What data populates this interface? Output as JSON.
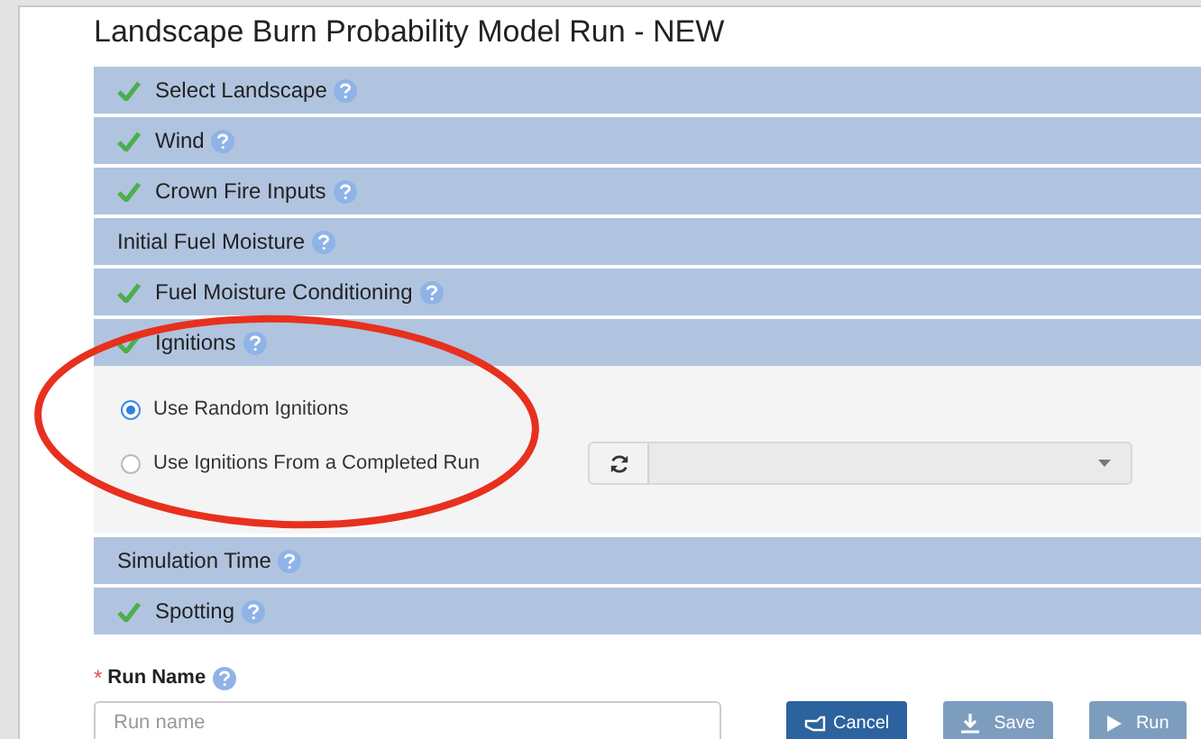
{
  "title": "Landscape Burn Probability Model Run - NEW",
  "sections": [
    {
      "label": "Select Landscape",
      "completed": true
    },
    {
      "label": "Wind",
      "completed": true
    },
    {
      "label": "Crown Fire Inputs",
      "completed": true
    },
    {
      "label": "Initial Fuel Moisture",
      "completed": false
    },
    {
      "label": "Fuel Moisture Conditioning",
      "completed": true
    },
    {
      "label": "Ignitions",
      "completed": true,
      "options": [
        {
          "label": "Use Random Ignitions",
          "selected": true
        },
        {
          "label": "Use Ignitions From a Completed Run",
          "selected": false
        }
      ]
    },
    {
      "label": "Simulation Time",
      "completed": false
    },
    {
      "label": "Spotting",
      "completed": true
    }
  ],
  "run_name": {
    "required_mark": "*",
    "label": "Run Name",
    "placeholder": "Run name"
  },
  "buttons": [
    {
      "label": "Cancel",
      "kind": "cancel",
      "disabled": false
    },
    {
      "label": "Save",
      "kind": "save",
      "disabled": true
    },
    {
      "label": "Run",
      "kind": "run",
      "disabled": true
    }
  ]
}
